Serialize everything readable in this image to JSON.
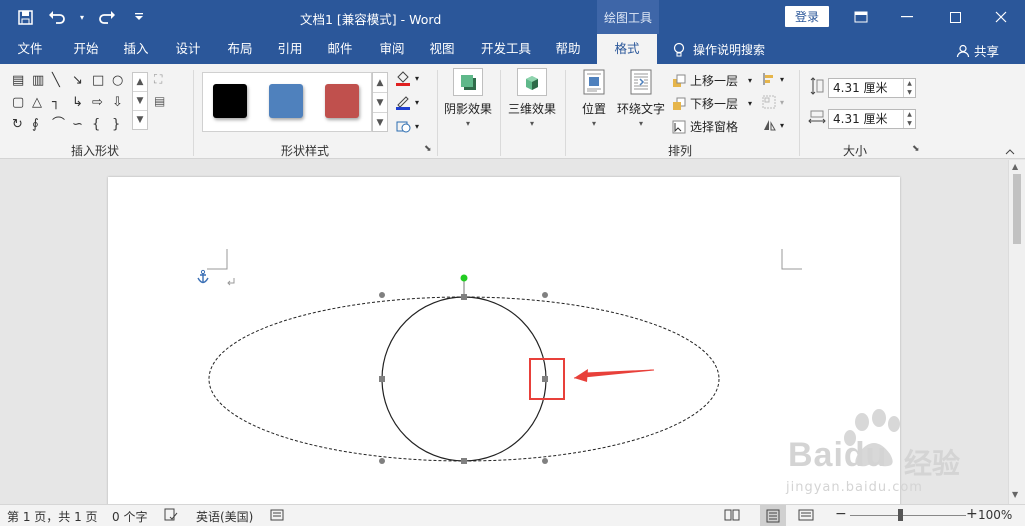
{
  "qat": {
    "save_icon": "save-icon",
    "undo_icon": "undo-icon",
    "redo_icon": "redo-icon",
    "customize_icon": "customize-qat-icon"
  },
  "window": {
    "title": "文档1 [兼容模式]  -  Word",
    "context_tools": "绘图工具",
    "login": "登录"
  },
  "tabs": [
    "文件",
    "开始",
    "插入",
    "设计",
    "布局",
    "引用",
    "邮件",
    "审阅",
    "视图",
    "开发工具",
    "帮助",
    "格式"
  ],
  "active_tab": "格式",
  "tellme": "操作说明搜索",
  "share": "共享",
  "ribbon": {
    "groups": {
      "insert_shapes": "插入形状",
      "shape_styles": "形状样式",
      "arrange": "排列",
      "size": "大小"
    },
    "swatch_colors": [
      "#000000",
      "#4f81bd",
      "#c0504d"
    ],
    "shadow_effects": "阴影效果",
    "three_d_effects": "三维效果",
    "position": "位置",
    "wrap_text": "环绕文字",
    "bring_forward": "上移一层",
    "send_backward": "下移一层",
    "selection_pane": "选择窗格",
    "height_value": "4.31 厘米",
    "width_value": "4.31 厘米"
  },
  "statusbar": {
    "page": "第 1 页，共 1 页",
    "words": "0 个字",
    "language": "英语(美国)",
    "zoom": "100%"
  },
  "watermark": {
    "brand": "Baidu",
    "cn": "经验",
    "url": "jingyan.baidu.com"
  },
  "colors": {
    "word_blue": "#2b579a",
    "annotation_red": "#e8403a",
    "rotate_handle": "#22cc22"
  }
}
